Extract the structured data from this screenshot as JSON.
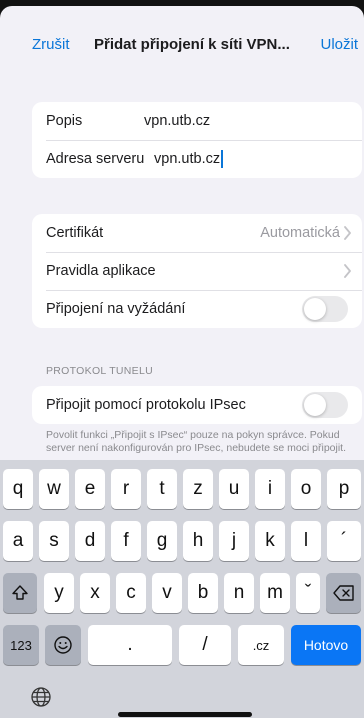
{
  "nav": {
    "cancel_label": "Zrušit",
    "title": "Přidat připojení k síti VPN...",
    "save_label": "Uložit"
  },
  "group1": {
    "description_label": "Popis",
    "description_value": "vpn.utb.cz",
    "server_label": "Adresa serveru",
    "server_value": "vpn.utb.cz"
  },
  "group2": {
    "certificate_label": "Certifikát",
    "certificate_value": "Automatická",
    "app_rules_label": "Pravidla aplikace",
    "on_demand_label": "Připojení na vyžádání",
    "on_demand_on": false
  },
  "tunnel": {
    "section_header": "PROTOKOL TUNELU",
    "ipsec_label": "Připojit pomocí protokolu IPsec",
    "ipsec_on": false,
    "footer": "Povolit funkci „Připojit s IPsec“ pouze na pokyn správce. Pokud server není nakonfigurován pro IPsec, nebudete se moci připojit."
  },
  "keyboard": {
    "row1": [
      "q",
      "w",
      "e",
      "r",
      "t",
      "z",
      "u",
      "i",
      "o",
      "p"
    ],
    "row2": [
      "a",
      "s",
      "d",
      "f",
      "g",
      "h",
      "j",
      "k",
      "l",
      "´"
    ],
    "row3": [
      "y",
      "x",
      "c",
      "v",
      "b",
      "n",
      "m",
      "ˇ"
    ],
    "numbers_label": "123",
    "dot_label": ".",
    "slash_label": "/",
    "cz_label": ".cz",
    "done_label": "Hotovo"
  },
  "colors": {
    "accent": "#0a76d8",
    "done_key": "#0a76f5",
    "background": "#f2f1f7"
  },
  "icons": [
    "chevron-right-icon",
    "shift-icon",
    "backspace-icon",
    "emoji-icon",
    "globe-icon"
  ]
}
